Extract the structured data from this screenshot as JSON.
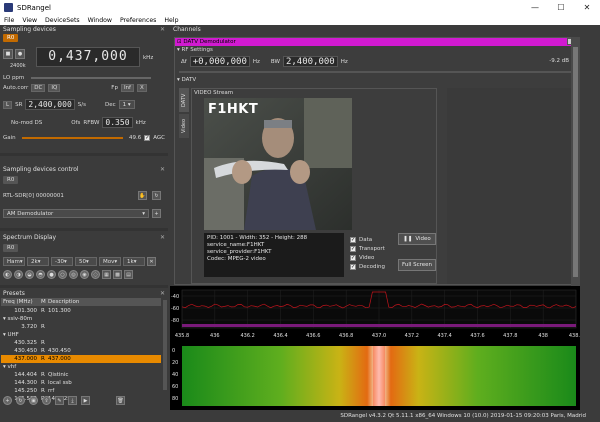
{
  "window": {
    "title": "SDRangel",
    "minimize": "—",
    "maximize": "☐",
    "close": "✕"
  },
  "menu": [
    "File",
    "View",
    "DeviceSets",
    "Window",
    "Preferences",
    "Help"
  ],
  "sampling_devices": {
    "title": "Sampling devices",
    "tab": "R0",
    "frequency": "0,437,000",
    "freq_unit": "kHz",
    "rate": "2400k",
    "lo_ppm_label": "LO ppm",
    "auto_corr_label": "Auto.corr",
    "dc_label": "DC",
    "iq_label": "IQ",
    "fp_label": "Fp",
    "fp_value": "Inf",
    "x_label": "X",
    "l_label": "L",
    "sr_label": "SR",
    "sr_value": "2,400,000",
    "sr_unit": "S/s",
    "dec_label": "Dec",
    "dec_value": "1",
    "nomod_label": "No-mod DS",
    "ofs_label": "Ofs",
    "rfbw_label": "RFBW",
    "rfbw_value": "0.350",
    "rfbw_unit": "kHz",
    "gain_label": "Gain",
    "gain_value": "49.6",
    "agc_label": "AGC"
  },
  "device_control": {
    "title": "Sampling devices control",
    "tab": "R0",
    "device_name": "RTL-SDR[0] 00000001",
    "demod_select": "AM Demodulator"
  },
  "spectrum_display": {
    "title": "Spectrum Display",
    "tab": "R0",
    "window_fn": "Ham",
    "fft_size": "2k",
    "ref": "-30",
    "range": "50",
    "avg_mode": "Mov",
    "avg": "1k"
  },
  "presets": {
    "title": "Presets",
    "headers": [
      "Freq (MHz)",
      "M",
      "Description"
    ],
    "rows": [
      {
        "freq": "101.300",
        "m": "R",
        "desc": "101.300",
        "indent": 2,
        "selected": false
      },
      {
        "freq": "",
        "m": "",
        "desc": "ssiv-80m",
        "indent": 0,
        "group": true,
        "selected": false
      },
      {
        "freq": "3.720",
        "m": "R",
        "desc": "",
        "indent": 2,
        "selected": false
      },
      {
        "freq": "",
        "m": "",
        "desc": "UHF",
        "indent": 0,
        "group": true,
        "selected": false
      },
      {
        "freq": "430.325",
        "m": "R",
        "desc": "",
        "indent": 2,
        "selected": false
      },
      {
        "freq": "430.450",
        "m": "R",
        "desc": "430.450",
        "indent": 2,
        "selected": false
      },
      {
        "freq": "437.000",
        "m": "R",
        "desc": "437.000",
        "indent": 2,
        "selected": true
      },
      {
        "freq": "",
        "m": "",
        "desc": "vhf",
        "indent": 0,
        "group": true,
        "selected": false
      },
      {
        "freq": "144.404",
        "m": "R",
        "desc": "Qistinic",
        "indent": 2,
        "selected": false
      },
      {
        "freq": "144.300",
        "m": "R",
        "desc": "local ssb",
        "indent": 2,
        "selected": false
      },
      {
        "freq": "145.250",
        "m": "R",
        "desc": "rrf",
        "indent": 2,
        "selected": false
      },
      {
        "freq": "145.525",
        "m": "R",
        "desc": "145.525",
        "indent": 2,
        "selected": false
      }
    ]
  },
  "channels": {
    "title": "Channels",
    "plugin_title": "DATV Demodulator",
    "rf_settings": "RF Settings",
    "delta_f_label": "Δf",
    "delta_f_value": "+0,000,000",
    "delta_f_unit": "Hz",
    "bw_label": "BW",
    "bw_value": "2,400,000",
    "bw_unit": "Hz",
    "level": "-9.2 dB",
    "datv_section": "DATV",
    "datv_tab": "DATV",
    "video_tab": "Video",
    "video_stream": "VIDEO Stream",
    "callsign": "F1HKT",
    "info_lines": [
      "PID: 1001 - Width: 352 - Height: 288",
      "service_name:F1HKT",
      "service_provider:F1HKT",
      "Codec: MPEG-2 video"
    ],
    "checks": [
      "Data",
      "Transport",
      "Video",
      "Decoding"
    ],
    "video_button": "Video",
    "fullscreen_button": "Full Screen"
  },
  "spectrum": {
    "db_ticks": [
      "-40",
      "-60",
      "-80"
    ],
    "freq_ticks": [
      "435.8",
      "436",
      "436.2",
      "436.4",
      "436.6",
      "436.8",
      "437.0",
      "437.2",
      "437.4",
      "437.6",
      "437.8",
      "438",
      "438.2"
    ],
    "wf_ticks": [
      "0",
      "20",
      "40",
      "60",
      "80"
    ]
  },
  "status": {
    "text": "SDRangel v4.3.2 Qt 5.11.1 x86_64 Windows 10 (10.0)   2019-01-15 09:20:03 Paris, Madrid"
  },
  "colors": {
    "accent": "#c26a00",
    "plugin": "#d11ad1",
    "selection": "#e88a00"
  }
}
